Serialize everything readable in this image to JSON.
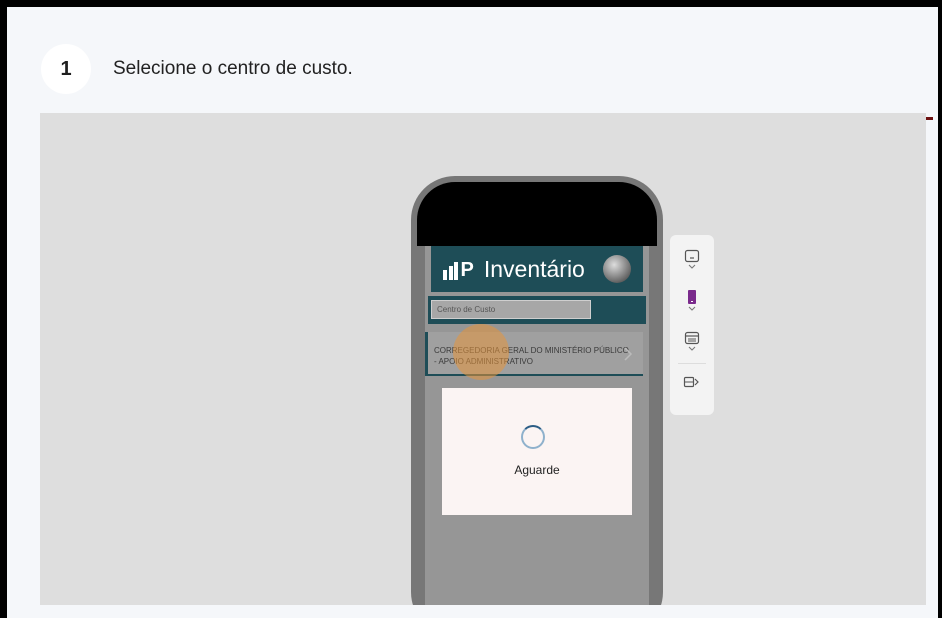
{
  "step": {
    "number": "1",
    "instruction": "Selecione o centro de custo."
  },
  "app": {
    "title": "Inventário",
    "cost_center_placeholder": "Centro de Custo",
    "list_items": [
      {
        "label": "CORREGEDORIA GERAL DO MINISTÉRIO PÚBLICO - APOIO ADMINISTRATIVO"
      }
    ],
    "loading_text": "Aguarde"
  },
  "colors": {
    "header_bg": "#1e4d57",
    "step_divider": "#6d1111",
    "stage_bg": "#dedede",
    "highlight": "#e6963c",
    "toolbar_accent": "#7a2a8c"
  },
  "toolbar": {
    "icons": [
      "phone-frame-icon",
      "phone-device-icon",
      "layout-icon",
      "export-icon"
    ]
  }
}
